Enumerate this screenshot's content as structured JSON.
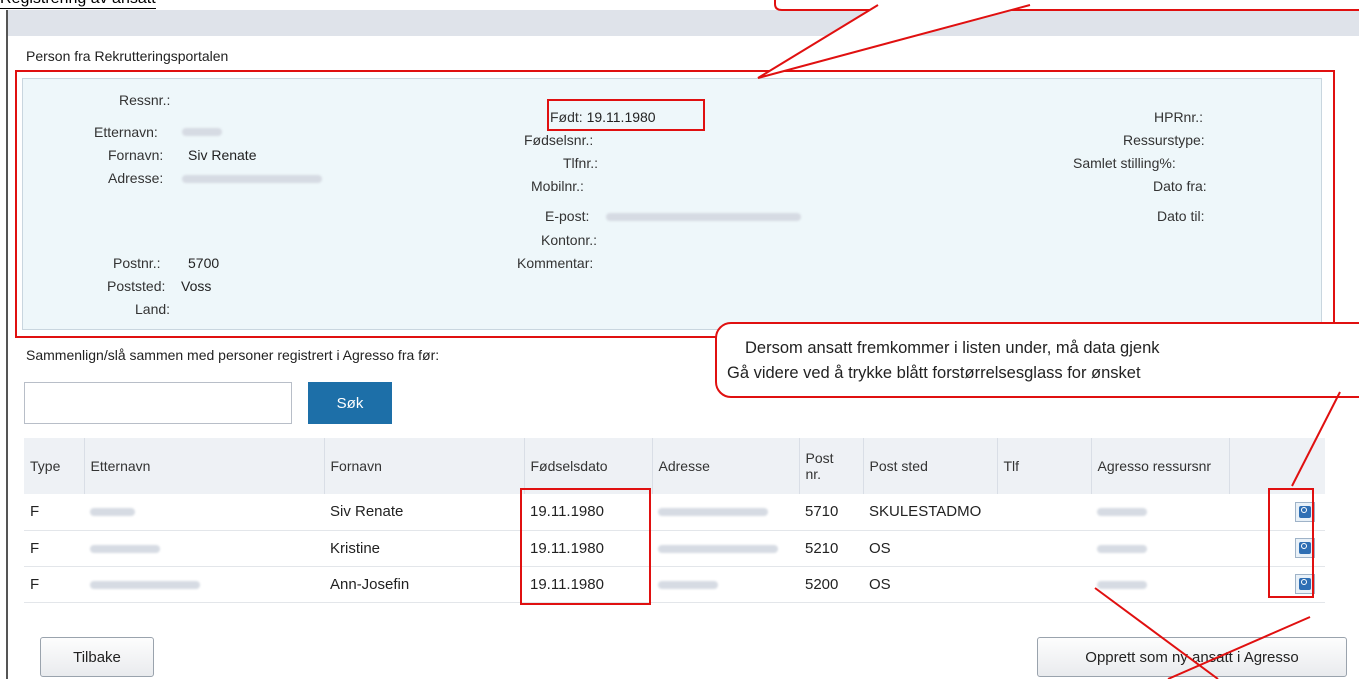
{
  "page": {
    "heading": "Registrering av ansatt"
  },
  "person_panel": {
    "section_title": "Person fra Rekrutteringsportalen",
    "fields_left": [
      {
        "label": "Ressnr.:",
        "value": ""
      },
      {
        "label": "Etternavn:",
        "value": ""
      },
      {
        "label": "Fornavn:",
        "value": "Siv Renate"
      },
      {
        "label": "Adresse:",
        "value": ""
      },
      {
        "label": "Postnr.:",
        "value": "5700"
      },
      {
        "label": "Poststed:",
        "value": "Voss"
      },
      {
        "label": "Land:",
        "value": ""
      }
    ],
    "fields_mid": [
      {
        "label": "Født:",
        "value": "19.11.1980"
      },
      {
        "label": "Fødselsnr.:",
        "value": ""
      },
      {
        "label": "Tlfnr.:",
        "value": ""
      },
      {
        "label": "Mobilnr.:",
        "value": ""
      },
      {
        "label": "E-post:",
        "value": ""
      },
      {
        "label": "Kontonr.:",
        "value": ""
      },
      {
        "label": "Kommentar:",
        "value": ""
      }
    ],
    "fields_right": [
      {
        "label": "HPRnr.:",
        "value": ""
      },
      {
        "label": "Ressurstype:",
        "value": ""
      },
      {
        "label": "Samlet stilling%:",
        "value": ""
      },
      {
        "label": "Dato fra:",
        "value": ""
      },
      {
        "label": "Dato til:",
        "value": ""
      }
    ]
  },
  "callout": {
    "line1": "Dersom ansatt fremkommer i listen under, må data gjenk",
    "line2": "Gå videre ved å trykke blått forstørrelsesglass for ønsket"
  },
  "compare": {
    "label": "Sammenlign/slå sammen med personer registrert i Agresso fra før:",
    "search_value": "",
    "search_button": "Søk"
  },
  "table": {
    "headers": {
      "type": "Type",
      "etternavn": "Etternavn",
      "fornavn": "Fornavn",
      "fodselsdato": "Fødselsdato",
      "adresse": "Adresse",
      "postnr_line1": "Post",
      "postnr_line2": "nr.",
      "poststed": "Post sted",
      "tlf": "Tlf",
      "agresso": "Agresso ressursnr"
    },
    "rows": [
      {
        "type": "F",
        "fornavn": "Siv Renate",
        "fodselsdato": "19.11.1980",
        "postnr": "5710",
        "poststed": "SKULESTADMO"
      },
      {
        "type": "F",
        "fornavn": "Kristine",
        "fodselsdato": "19.11.1980",
        "postnr": "5210",
        "poststed": "OS"
      },
      {
        "type": "F",
        "fornavn": "Ann-Josefin",
        "fodselsdato": "19.11.1980",
        "postnr": "5200",
        "poststed": "OS"
      }
    ]
  },
  "buttons": {
    "back": "Tilbake",
    "create": "Opprett som ny ansatt i Agresso"
  },
  "colors": {
    "annotation": "#e01010",
    "accent": "#1d6fa8",
    "panel": "#eef7fa"
  }
}
